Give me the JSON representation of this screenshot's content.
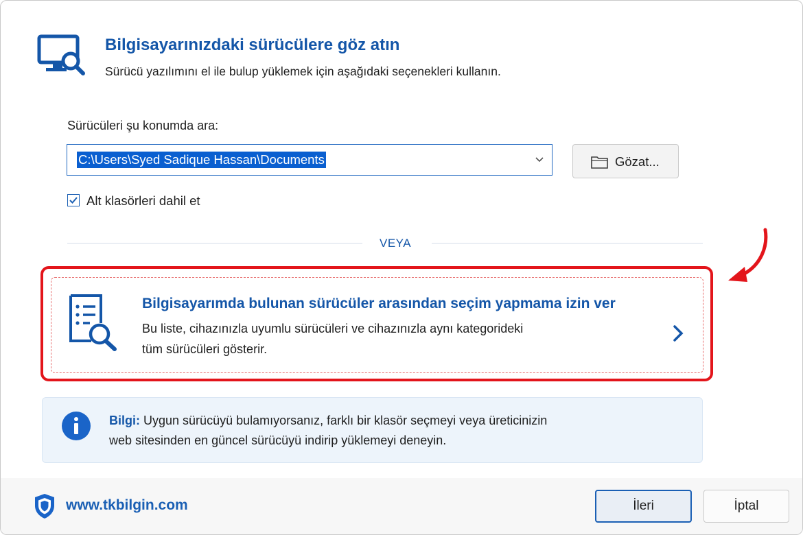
{
  "header": {
    "title": "Bilgisayarınızdaki sürücülere göz atın",
    "subtitle": "Sürücü yazılımını el ile bulup yüklemek için aşağıdaki seçenekleri kullanın.",
    "icon": "computer-search-icon"
  },
  "search": {
    "label": "Sürücüleri şu konumda ara:",
    "path_value": "C:\\Users\\Syed Sadique Hassan\\Documents",
    "browse_label": "Gözat...",
    "include_subfolders_label": "Alt klasörleri dahil et",
    "include_subfolders_checked": true
  },
  "separator": {
    "text": "VEYA"
  },
  "option": {
    "title": "Bilgisayarımda bulunan sürücüler arasından seçim yapmama izin ver",
    "description_line1": "Bu liste, cihazınızla uyumlu sürücüleri ve cihazınızla aynı kategorideki",
    "description_line2": "tüm sürücüleri gösterir.",
    "icon": "document-search-icon"
  },
  "info": {
    "label": "Bilgi:",
    "line1": "Uygun sürücüyü bulamıyorsanız, farklı bir klasör seçmeyi veya üreticinizin",
    "line2": "web sitesinden en güncel sürücüyü indirip yüklemeyi deneyin."
  },
  "footer": {
    "link": "www.tkbilgin.com",
    "next_label": "İleri",
    "cancel_label": "İptal"
  },
  "colors": {
    "accent": "#1456a8",
    "highlight": "#e3151b",
    "selection": "#0a5fd0",
    "info_bg": "#edf4fb"
  }
}
